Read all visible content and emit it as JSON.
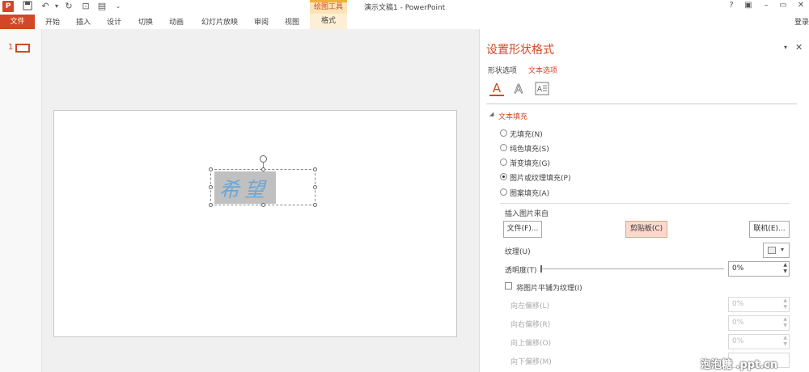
{
  "titlebar": {
    "app_title": "演示文稿1 - PowerPoint",
    "context_tab_group": "绘图工具",
    "window_controls": [
      "?",
      "▣",
      "–",
      "▭",
      "✕"
    ]
  },
  "ribbon": {
    "file_tab": "文件",
    "tabs": [
      "开始",
      "插入",
      "设计",
      "切换",
      "动画",
      "幻灯片放映",
      "审阅",
      "视图"
    ],
    "format_tab": "格式",
    "login": "登录"
  },
  "thumbnails": {
    "slide_number": "1"
  },
  "panel": {
    "title": "设置形状格式",
    "tabs": {
      "shape_options": "形状选项",
      "text_options": "文本选项"
    },
    "section": "文本填充",
    "fill_options": [
      {
        "label": "无填充(N)",
        "selected": false
      },
      {
        "label": "纯色填充(S)",
        "selected": false
      },
      {
        "label": "渐变填充(G)",
        "selected": false
      },
      {
        "label": "图片或纹理填充(P)",
        "selected": true
      },
      {
        "label": "图案填充(A)",
        "selected": false
      }
    ],
    "insert_from": "插入图片来自",
    "btn_file": "文件(F)...",
    "btn_clipboard": "剪贴板(C)",
    "btn_online": "联机(E)...",
    "texture_label": "纹理(U)",
    "transparency_label": "透明度(T)",
    "transparency_value": "0%",
    "tile_label": "将图片平铺为纹理(I)",
    "offsets": [
      {
        "label": "向左偏移(L)",
        "value": "0%"
      },
      {
        "label": "向右偏移(R)",
        "value": "0%"
      },
      {
        "label": "向上偏移(O)",
        "value": "0%"
      },
      {
        "label": "向下偏移(M)",
        "value": ""
      }
    ]
  },
  "slide": {
    "text": "希望"
  },
  "watermark": "泡泡糖 .ppt.cn",
  "colors": {
    "accent": "#d24726",
    "context_tab": "#fce4b8"
  }
}
